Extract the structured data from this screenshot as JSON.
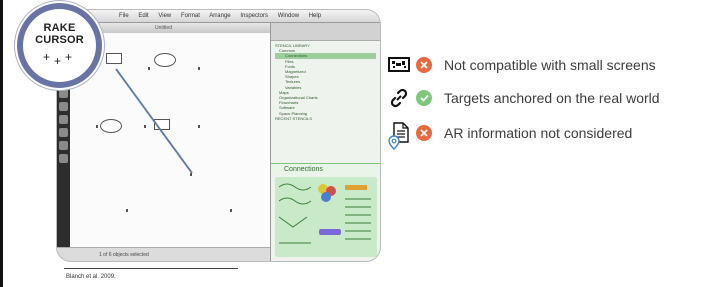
{
  "badge": {
    "line1": "RAKE",
    "line2": "CURSOR"
  },
  "screenshot": {
    "menu": [
      "File",
      "Edit",
      "View",
      "Format",
      "Arrange",
      "Inspectors",
      "Window",
      "Help"
    ],
    "window_title": "Untitled",
    "status_text": "1 of 6 objects selected",
    "side_panel_heading": "Connections",
    "tree_items": [
      "STENCIL LIBRARY",
      "Common",
      "Connections",
      "Files",
      "Fonts",
      "Magnetized",
      "Shapes",
      "Textures",
      "Variables",
      "Maps",
      "Organizational Charts",
      "Flowcharts",
      "Software",
      "Space Planning",
      "RECENT STENCILS"
    ]
  },
  "criteria": [
    {
      "icon": "small-screen-icon",
      "status": "fail",
      "status_color": "#e8683f",
      "label": "Not compatible with small screens"
    },
    {
      "icon": "link-icon",
      "status": "pass",
      "status_color": "#7ec87a",
      "label": "Targets anchored on the real world"
    },
    {
      "icon": "ar-document-icon",
      "status": "fail",
      "status_color": "#e8683f",
      "label": "AR information not considered"
    }
  ],
  "reference": "Blanch et al. 2009."
}
